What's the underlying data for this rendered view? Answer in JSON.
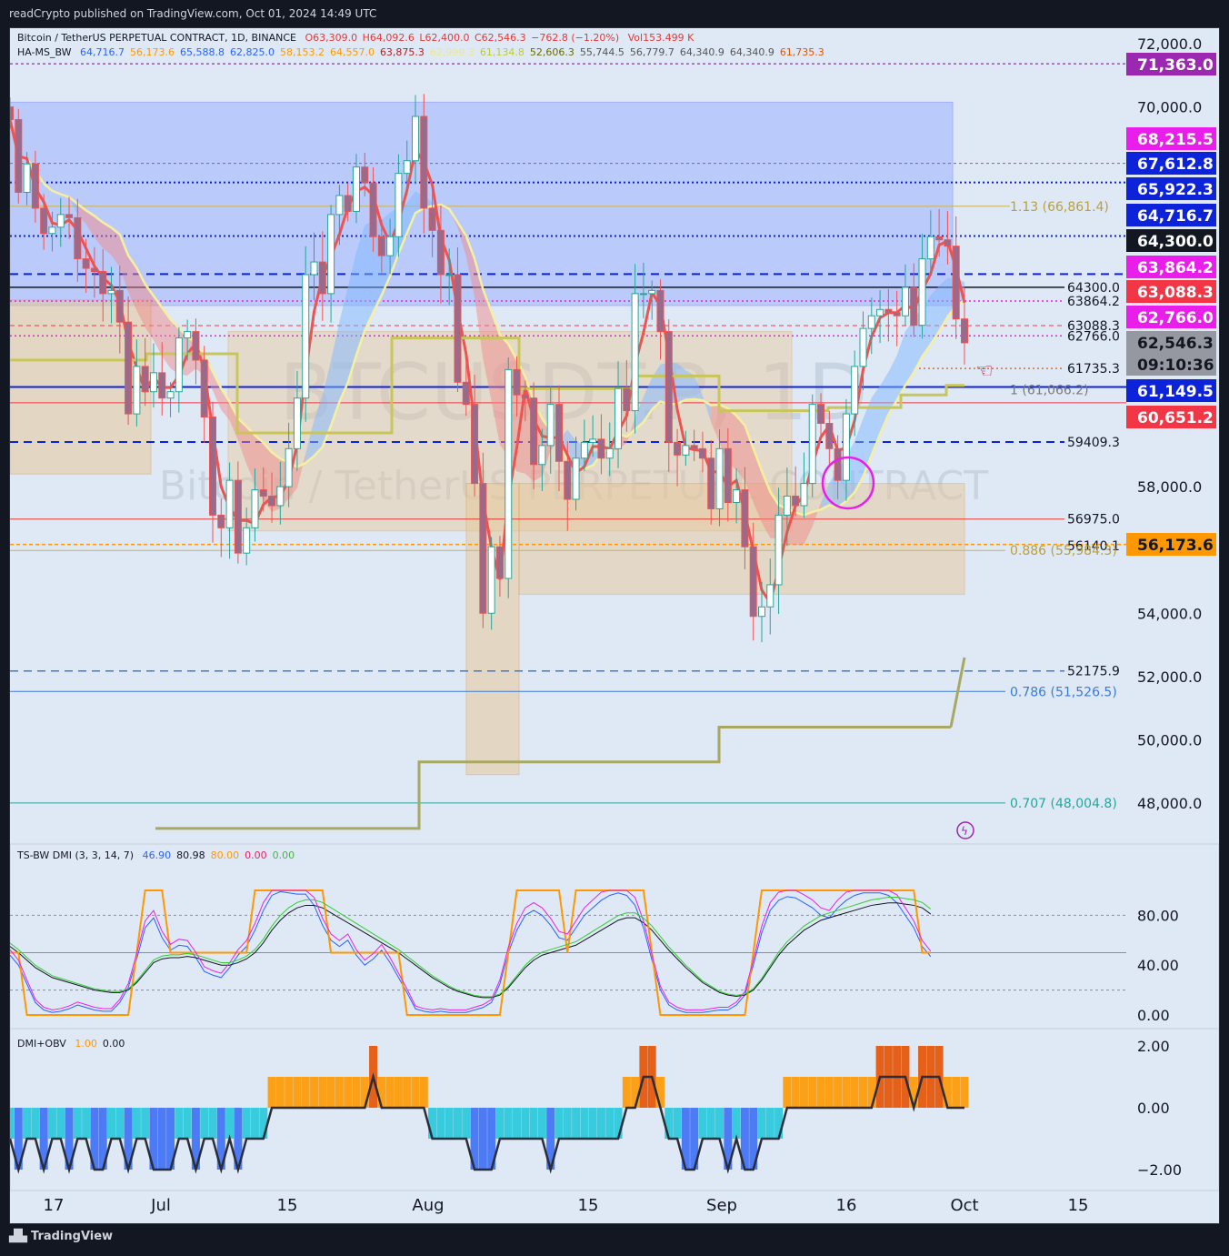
{
  "header": {
    "published": "readCrypto published on TradingView.com, Oct 01, 2024 14:49 UTC"
  },
  "legend_main": {
    "symbol": "Bitcoin / TetherUS PERPETUAL CONTRACT, 1D, BINANCE",
    "open": "O63,309.0",
    "high": "H64,092.6",
    "low": "L62,400.0",
    "close": "C62,546.3",
    "change": "−762.8 (−1.20%)",
    "volume": "Vol153.499 K",
    "indicator": "HA-MS_BW",
    "values": [
      {
        "v": "64,716.7",
        "color": "#2962ff"
      },
      {
        "v": "56,173.6",
        "color": "#ff9800"
      },
      {
        "v": "65,588.8",
        "color": "#2962ff"
      },
      {
        "v": "62,825.0",
        "color": "#2962ff"
      },
      {
        "v": "58,153.2",
        "color": "#ff9800"
      },
      {
        "v": "64,557.0",
        "color": "#ff9800"
      },
      {
        "v": "63,875.3",
        "color": "#b71c1c"
      },
      {
        "v": "62,999.3",
        "color": "#f0e68c"
      },
      {
        "v": "61,134.8",
        "color": "#c0ca33"
      },
      {
        "v": "52,606.3",
        "color": "#6b6b00"
      },
      {
        "v": "55,744.5",
        "color": "#555555"
      },
      {
        "v": "56,779.7",
        "color": "#555555"
      },
      {
        "v": "64,340.9",
        "color": "#555555"
      },
      {
        "v": "64,340.9",
        "color": "#555555"
      },
      {
        "v": "61,735.3",
        "color": "#e65100"
      }
    ]
  },
  "watermark": {
    "big": "BTCUSDT.P, 1D",
    "small": "Bitcoin / TetherUS PERPETUAL CONTRACT"
  },
  "price_axis": {
    "ticks": [
      "72,000.0",
      "70,000.0",
      "58,000.0",
      "54,000.0",
      "52,000.0",
      "50,000.0",
      "48,000.0"
    ]
  },
  "price_tags": [
    {
      "label": "71,363.0",
      "bg": "#9c27b0",
      "fg": "#ffffff",
      "value": 71363
    },
    {
      "label": "68,215.5",
      "bg": "#e91eeb",
      "fg": "#ffffff",
      "value": 68215.5
    },
    {
      "label": "67,612.8",
      "bg": "#0d23d9",
      "fg": "#ffffff",
      "value": 67612.8
    },
    {
      "label": "65,922.3",
      "bg": "#0d23d9",
      "fg": "#ffffff",
      "value": 65922.3
    },
    {
      "label": "64,716.7",
      "bg": "#0d23d9",
      "fg": "#ffffff",
      "value": 64716.7
    },
    {
      "label": "64,300.0",
      "bg": "#131722",
      "fg": "#ffffff",
      "value": 64300
    },
    {
      "label": "63,864.2",
      "bg": "#e91eeb",
      "fg": "#ffffff",
      "value": 63864.2
    },
    {
      "label": "63,088.3",
      "bg": "#f23645",
      "fg": "#ffffff",
      "value": 63088.3
    },
    {
      "label": "62,766.0",
      "bg": "#e91eeb",
      "fg": "#ffffff",
      "value": 62766
    },
    {
      "label": "62,546.3",
      "bg": "#9598a1",
      "fg": "#131722",
      "value": 62546.3
    },
    {
      "label": "09:10:36",
      "bg": "#9598a1",
      "fg": "#131722",
      "value": null
    },
    {
      "label": "61,149.5",
      "bg": "#0d23d9",
      "fg": "#ffffff",
      "value": 61149.5
    },
    {
      "label": "60,651.2",
      "bg": "#f23645",
      "fg": "#ffffff",
      "value": 60651.2
    },
    {
      "label": "56,173.6",
      "bg": "#ff9800",
      "fg": "#131722",
      "value": 56173.6
    }
  ],
  "level_labels": [
    {
      "text": "64300.0",
      "value": 64300
    },
    {
      "text": "63864.2",
      "value": 63864.2
    },
    {
      "text": "63088.3",
      "value": 63088.3
    },
    {
      "text": "62766.0",
      "value": 62766
    },
    {
      "text": "61735.3",
      "value": 61735.3
    },
    {
      "text": "59409.3",
      "value": 59409.3
    },
    {
      "text": "56975.0",
      "value": 56975
    },
    {
      "text": "56140.1",
      "value": 56140.1
    },
    {
      "text": "52175.9",
      "value": 52175.9
    }
  ],
  "fib_labels": [
    {
      "text": "1.13 (66,861.4)",
      "value": 66861.4,
      "color": "#b8a040"
    },
    {
      "text": "1 (61,066.2)",
      "value": 61066.2,
      "color": "#7a7a7a"
    },
    {
      "text": "0.886 (55,984.3)",
      "value": 55984.3,
      "color": "#b8a040"
    },
    {
      "text": "0.786 (51,526.5)",
      "value": 51526.5,
      "color": "#3a7bd5"
    },
    {
      "text": "0.707 (48,004.8)",
      "value": 48004.8,
      "color": "#26a69a"
    }
  ],
  "date_axis": {
    "labels": [
      "17",
      "Jul",
      "15",
      "Aug",
      "15",
      "Sep",
      "16",
      "Oct",
      "15"
    ]
  },
  "dmi_panel": {
    "title": "TS-BW DMI (3, 3, 14, 7)",
    "values": [
      {
        "v": "46.90",
        "color": "#2962ff"
      },
      {
        "v": "80.98",
        "color": "#131722"
      },
      {
        "v": "80.00",
        "color": "#ff9800"
      },
      {
        "v": "0.00",
        "color": "#e91e63"
      },
      {
        "v": "0.00",
        "color": "#4caf50"
      }
    ],
    "ticks": [
      "80.00",
      "40.00",
      "0.00"
    ]
  },
  "obv_panel": {
    "title": "DMI+OBV",
    "values": [
      {
        "v": "1.00",
        "color": "#ff9800"
      },
      {
        "v": "0.00",
        "color": "#131722"
      }
    ],
    "ticks": [
      "2.00",
      "0.00",
      "−2.00"
    ]
  },
  "footer": {
    "brand": "TradingView"
  },
  "chart_data": [
    {
      "type": "candlestick",
      "title": "Bitcoin / TetherUS PERPETUAL CONTRACT, 1D, BINANCE",
      "x": [
        "Jun 10",
        "Jun 11",
        "Jun 12",
        "Jun 13",
        "Jun 14",
        "Jun 15",
        "Jun 16",
        "Jun 17",
        "Jun 18",
        "Jun 19",
        "Jun 20",
        "Jun 21",
        "Jun 22",
        "Jun 23",
        "Jun 24",
        "Jun 25",
        "Jun 26",
        "Jun 27",
        "Jun 28",
        "Jun 29",
        "Jun 30",
        "Jul 1",
        "Jul 2",
        "Jul 3",
        "Jul 4",
        "Jul 5",
        "Jul 6",
        "Jul 7",
        "Jul 8",
        "Jul 9",
        "Jul 10",
        "Jul 11",
        "Jul 12",
        "Jul 13",
        "Jul 14",
        "Jul 15",
        "Jul 16",
        "Jul 17",
        "Jul 18",
        "Jul 19",
        "Jul 20",
        "Jul 21",
        "Jul 22",
        "Jul 23",
        "Jul 24",
        "Jul 25",
        "Jul 26",
        "Jul 27",
        "Jul 28",
        "Jul 29",
        "Jul 30",
        "Jul 31",
        "Aug 1",
        "Aug 2",
        "Aug 3",
        "Aug 4",
        "Aug 5",
        "Aug 6",
        "Aug 7",
        "Aug 8",
        "Aug 9",
        "Aug 10",
        "Aug 11",
        "Aug 12",
        "Aug 13",
        "Aug 14",
        "Aug 15",
        "Aug 16",
        "Aug 17",
        "Aug 18",
        "Aug 19",
        "Aug 20",
        "Aug 21",
        "Aug 22",
        "Aug 23",
        "Aug 24",
        "Aug 25",
        "Aug 26",
        "Aug 27",
        "Aug 28",
        "Aug 29",
        "Aug 30",
        "Aug 31",
        "Sep 1",
        "Sep 2",
        "Sep 3",
        "Sep 4",
        "Sep 5",
        "Sep 6",
        "Sep 7",
        "Sep 8",
        "Sep 9",
        "Sep 10",
        "Sep 11",
        "Sep 12",
        "Sep 13",
        "Sep 14",
        "Sep 15",
        "Sep 16",
        "Sep 17",
        "Sep 18",
        "Sep 19",
        "Sep 20",
        "Sep 21",
        "Sep 22",
        "Sep 23",
        "Sep 24",
        "Sep 25",
        "Sep 26",
        "Sep 27",
        "Sep 28",
        "Sep 29",
        "Sep 30",
        "Oct 1"
      ],
      "close": [
        69600,
        67300,
        68200,
        66800,
        66000,
        66200,
        66600,
        66500,
        65200,
        64900,
        64800,
        64100,
        64200,
        63200,
        60300,
        61800,
        61000,
        61600,
        60800,
        61000,
        62700,
        62900,
        62000,
        60200,
        57100,
        56700,
        58200,
        55900,
        56700,
        57900,
        57700,
        57400,
        58000,
        59200,
        60800,
        64700,
        65100,
        64100,
        66600,
        67200,
        66700,
        68100,
        67600,
        65900,
        65300,
        65900,
        67900,
        68300,
        69700,
        66800,
        66100,
        64700,
        64700,
        61300,
        60600,
        58100,
        54000,
        56100,
        55100,
        61700,
        60900,
        60800,
        58700,
        59300,
        60600,
        58800,
        57600,
        58900,
        59400,
        59500,
        58900,
        59200,
        61100,
        60400,
        64100,
        64100,
        64200,
        62900,
        59400,
        59000,
        59300,
        59200,
        58900,
        57300,
        59200,
        57500,
        57900,
        56100,
        53900,
        54200,
        54900,
        57100,
        57700,
        57400,
        58100,
        60600,
        60000,
        59200,
        58200,
        60300,
        61800,
        63000,
        63400,
        63600,
        63500,
        63400,
        64300,
        63100,
        65200,
        65900,
        65800,
        65600,
        63300,
        62546
      ]
    },
    {
      "type": "line",
      "title": "TS-BW DMI (3, 3, 14, 7)",
      "ylim": [
        0,
        100
      ],
      "series": [
        {
          "name": "46.90",
          "values": [
            48,
            40,
            25,
            10,
            4,
            2,
            3,
            5,
            8,
            6,
            4,
            3,
            3,
            10,
            22,
            45,
            70,
            78,
            62,
            52,
            56,
            55,
            46,
            35,
            32,
            30,
            38,
            48,
            55,
            68,
            84,
            96,
            99,
            98,
            97,
            97,
            88,
            72,
            60,
            55,
            60,
            48,
            40,
            45,
            52,
            42,
            30,
            18,
            5,
            3,
            2,
            3,
            2,
            2,
            2,
            4,
            6,
            10,
            25,
            50,
            68,
            80,
            84,
            80,
            72,
            62,
            60,
            70,
            80,
            86,
            92,
            96,
            98,
            96,
            88,
            70,
            44,
            20,
            8,
            4,
            2,
            2,
            2,
            3,
            4,
            4,
            8,
            16,
            40,
            66,
            84,
            92,
            95,
            94,
            90,
            86,
            80,
            78,
            86,
            92,
            96,
            98,
            98,
            98,
            96,
            90,
            80,
            70,
            55,
            46.9
          ]
        },
        {
          "name": "80.98",
          "values": [
            55,
            50,
            44,
            38,
            34,
            30,
            28,
            26,
            24,
            22,
            20,
            19,
            18,
            18,
            20,
            26,
            34,
            42,
            45,
            46,
            46,
            47,
            46,
            44,
            42,
            40,
            40,
            42,
            45,
            50,
            58,
            68,
            76,
            82,
            86,
            88,
            88,
            86,
            82,
            78,
            74,
            70,
            66,
            62,
            58,
            54,
            50,
            45,
            40,
            35,
            30,
            26,
            22,
            19,
            17,
            15,
            14,
            14,
            16,
            22,
            30,
            38,
            44,
            48,
            50,
            52,
            54,
            56,
            60,
            64,
            68,
            72,
            76,
            78,
            78,
            74,
            68,
            60,
            52,
            45,
            38,
            32,
            26,
            22,
            18,
            16,
            15,
            16,
            20,
            28,
            38,
            48,
            56,
            62,
            68,
            72,
            76,
            78,
            80,
            82,
            84,
            86,
            88,
            89,
            90,
            90,
            89,
            88,
            86,
            80.98
          ]
        }
      ]
    },
    {
      "type": "bar",
      "title": "DMI+OBV",
      "ylim": [
        -2.5,
        2.5
      ],
      "series": [
        {
          "name": "1.00",
          "values": [
            -1,
            -2,
            -1,
            -1,
            -2,
            -1,
            -1,
            -2,
            -1,
            -1,
            -2,
            -2,
            -1,
            -1,
            -2,
            -1,
            -1,
            -2,
            -2,
            -2,
            -1,
            -1,
            -2,
            -1,
            -1,
            -2,
            -1,
            -2,
            -1,
            -1,
            -1,
            1,
            1,
            1,
            1,
            1,
            1,
            1,
            1,
            1,
            1,
            1,
            1,
            2,
            1,
            1,
            1,
            1,
            1,
            1,
            -1,
            -1,
            -1,
            -1,
            -1,
            -2,
            -2,
            -2,
            -1,
            -1,
            -1,
            -1,
            -1,
            -1,
            -2,
            -1,
            -1,
            -1,
            -1,
            -1,
            -1,
            -1,
            -1,
            1,
            1,
            2,
            2,
            1,
            -1,
            -1,
            -2,
            -2,
            -1,
            -1,
            -1,
            -2,
            -1,
            -2,
            -2,
            -1,
            -1,
            -1,
            1,
            1,
            1,
            1,
            1,
            1,
            1,
            1,
            1,
            1,
            1,
            2,
            2,
            2,
            2,
            1,
            2,
            2,
            2,
            1,
            1,
            1
          ]
        }
      ]
    }
  ]
}
